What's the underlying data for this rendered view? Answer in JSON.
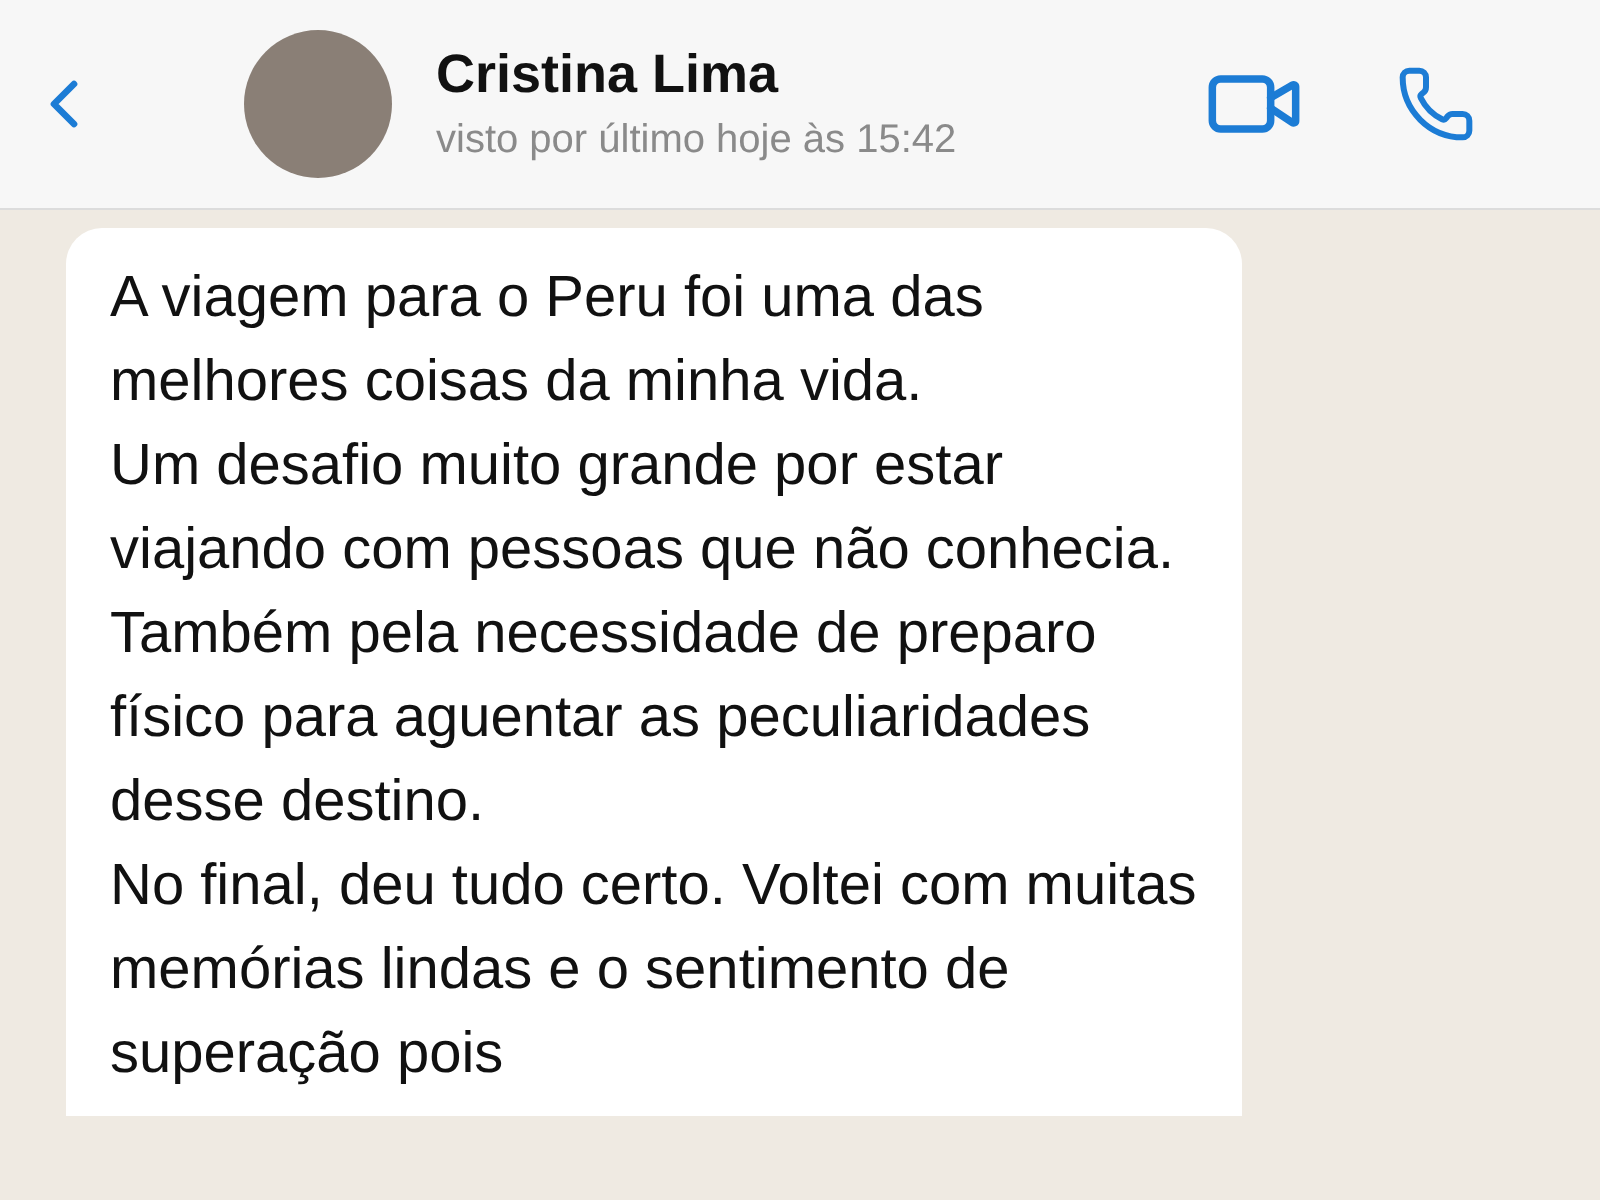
{
  "header": {
    "name": "Cristina Lima",
    "status": "visto por último hoje às 15:42"
  },
  "message": {
    "paragraphs": [
      "A viagem para o Peru foi uma das melhores coisas da minha vida.",
      "Um desafio muito grande por estar viajando com pessoas que não conhecia. Também pela necessidade de preparo físico para aguentar as peculiaridades desse destino.",
      "No final, deu tudo certo. Voltei com muitas memórias lindas e o sentimento de superação pois"
    ]
  }
}
